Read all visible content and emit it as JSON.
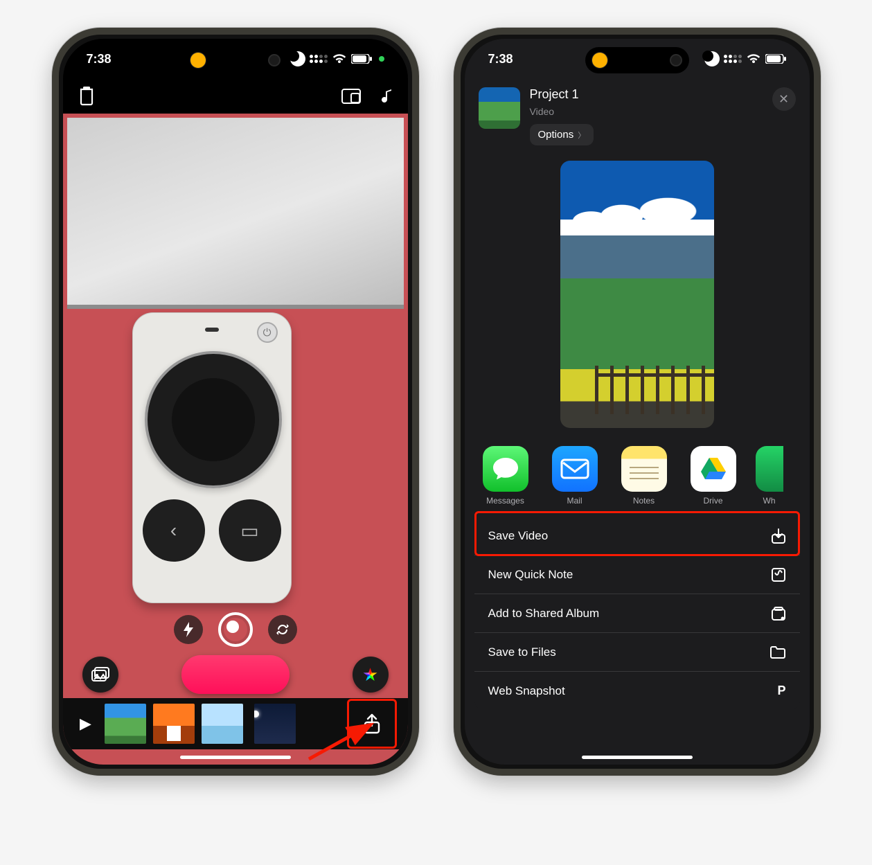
{
  "status": {
    "time": "7:38"
  },
  "left": {
    "thumbnails": [
      "mountain",
      "autumn",
      "pier",
      "moon"
    ],
    "share_highlighted": true
  },
  "right": {
    "project": {
      "title": "Project 1",
      "subtitle": "Video",
      "options_label": "Options"
    },
    "apps": [
      {
        "key": "messages",
        "label": "Messages"
      },
      {
        "key": "mail",
        "label": "Mail"
      },
      {
        "key": "notes",
        "label": "Notes"
      },
      {
        "key": "drive",
        "label": "Drive"
      },
      {
        "key": "whatsapp",
        "label": "Wh"
      }
    ],
    "actions": [
      {
        "key": "save_video",
        "label": "Save Video",
        "icon": "download",
        "highlighted": true
      },
      {
        "key": "quick_note",
        "label": "New Quick Note",
        "icon": "note"
      },
      {
        "key": "shared_album",
        "label": "Add to Shared Album",
        "icon": "album"
      },
      {
        "key": "save_files",
        "label": "Save to Files",
        "icon": "folder"
      },
      {
        "key": "web_snap",
        "label": "Web Snapshot",
        "icon": "p"
      }
    ]
  }
}
